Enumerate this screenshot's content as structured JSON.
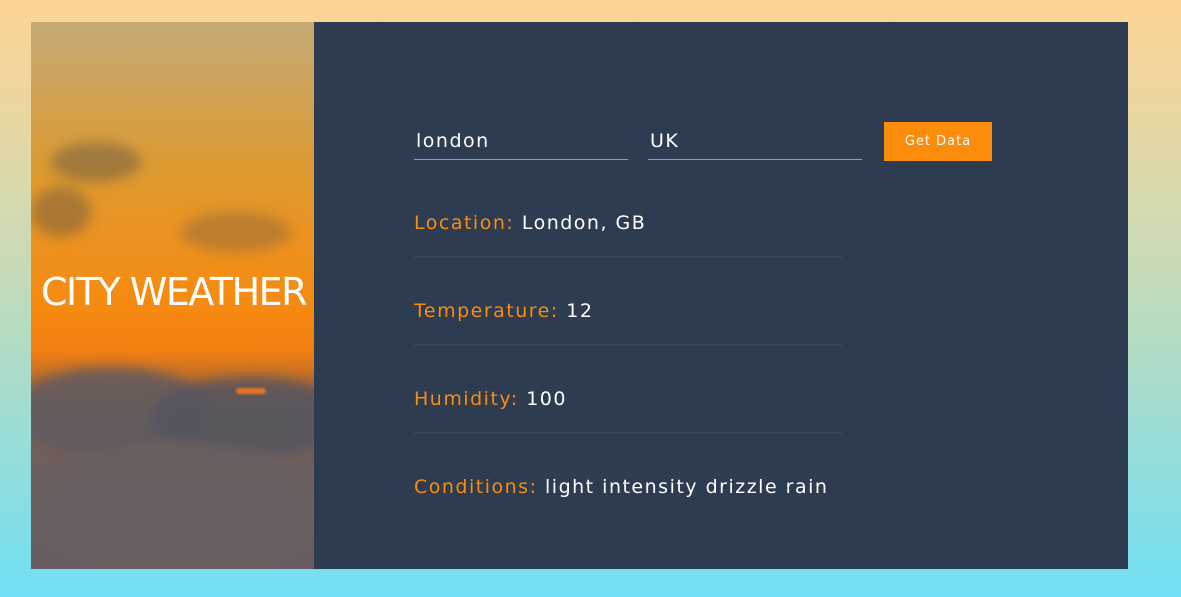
{
  "hero": {
    "title": "CITY WEATHER"
  },
  "form": {
    "city_value": "london",
    "country_value": "UK",
    "button_label": "Get Data"
  },
  "results": {
    "location_label": "Location:",
    "location_value": "London, GB",
    "temperature_label": "Temperature:",
    "temperature_value": "12",
    "humidity_label": "Humidity:",
    "humidity_value": "100",
    "conditions_label": "Conditions:",
    "conditions_value": "light intensity drizzle rain"
  },
  "colors": {
    "accent": "#fb8c0c",
    "panel_bg": "#2d3c50",
    "text": "#ffffff",
    "page_gradient_top": "#fed395",
    "page_gradient_bottom": "#72e0f4"
  }
}
